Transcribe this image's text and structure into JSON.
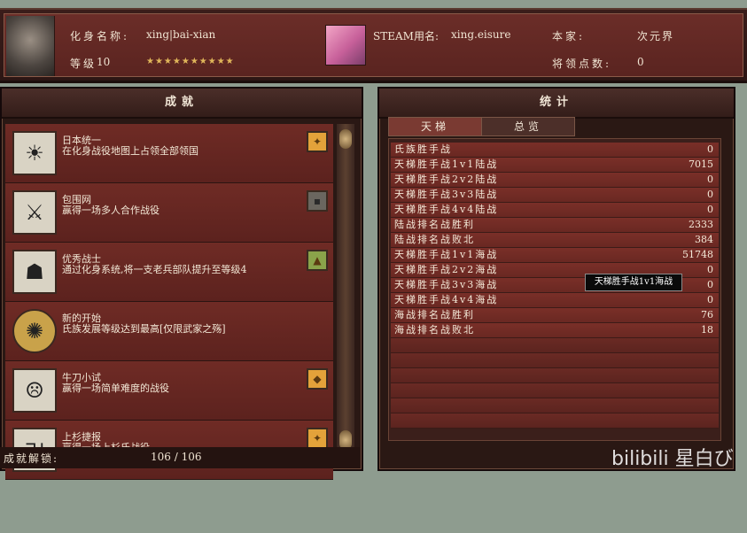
{
  "header": {
    "avatar_name_label": "化身名称:",
    "avatar_name": "xing|bai-xian",
    "level_label": "等级",
    "level": "10",
    "stars": "★★★★★★★★★★",
    "steam_label": "STEAM用名:",
    "steam_name": "xing.eisure",
    "clan_label": "本家:",
    "clan_value": "次元界",
    "general_points_label": "将领点数:",
    "general_points": "0"
  },
  "achievements_panel": {
    "title": "成就",
    "items": [
      {
        "title": "日本统一",
        "desc": "在化身战役地图上占领全部领国",
        "icon": "rising-sun-icon",
        "badge": "gold"
      },
      {
        "title": "包围网",
        "desc": "赢得一场多人合作战役",
        "icon": "ninja-icon",
        "badge": "grey"
      },
      {
        "title": "优秀战士",
        "desc": "通过化身系统,将一支老兵部队提升至等级4",
        "icon": "samurai-mask-icon",
        "badge": "gold-green"
      },
      {
        "title": "新的开始",
        "desc": "氏族发展等级达到最高[仅限武家之殇]",
        "icon": "gold-crest-icon",
        "badge": "none"
      },
      {
        "title": "牛刀小试",
        "desc": "赢得一场简单难度的战役",
        "icon": "noh-mask-icon",
        "badge": "gold"
      },
      {
        "title": "上杉捷报",
        "desc": "赢得一场上杉氏战役",
        "icon": "uesugi-icon",
        "badge": "gold"
      }
    ],
    "footer_label": "成就解锁:",
    "footer_value": "106 / 106"
  },
  "stats_panel": {
    "title": "统计",
    "tabs": [
      {
        "label": "天梯",
        "active": true
      },
      {
        "label": "总览",
        "active": false
      }
    ],
    "rows": [
      {
        "label": "氏族胜手战",
        "value": "0"
      },
      {
        "label": "天梯胜手战1v1陆战",
        "value": "7015"
      },
      {
        "label": "天梯胜手战2v2陆战",
        "value": "0"
      },
      {
        "label": "天梯胜手战3v3陆战",
        "value": "0"
      },
      {
        "label": "天梯胜手战4v4陆战",
        "value": "0"
      },
      {
        "label": "陆战排名战胜利",
        "value": "2333"
      },
      {
        "label": "陆战排名战败北",
        "value": "384"
      },
      {
        "label": "天梯胜手战1v1海战",
        "value": "51748"
      },
      {
        "label": "天梯胜手战2v2海战",
        "value": "0"
      },
      {
        "label": "天梯胜手战3v3海战",
        "value": "0"
      },
      {
        "label": "天梯胜手战4v4海战",
        "value": "0"
      },
      {
        "label": "海战排名战胜利",
        "value": "76"
      },
      {
        "label": "海战排名战败北",
        "value": "18"
      }
    ],
    "tooltip": "天梯胜手战1v1海战"
  },
  "watermark": "bilibili 星白び",
  "colors": {
    "panel_red": "#6f2b25",
    "dark_frame": "#2a1814",
    "gold_badge": "#e3a23a"
  }
}
